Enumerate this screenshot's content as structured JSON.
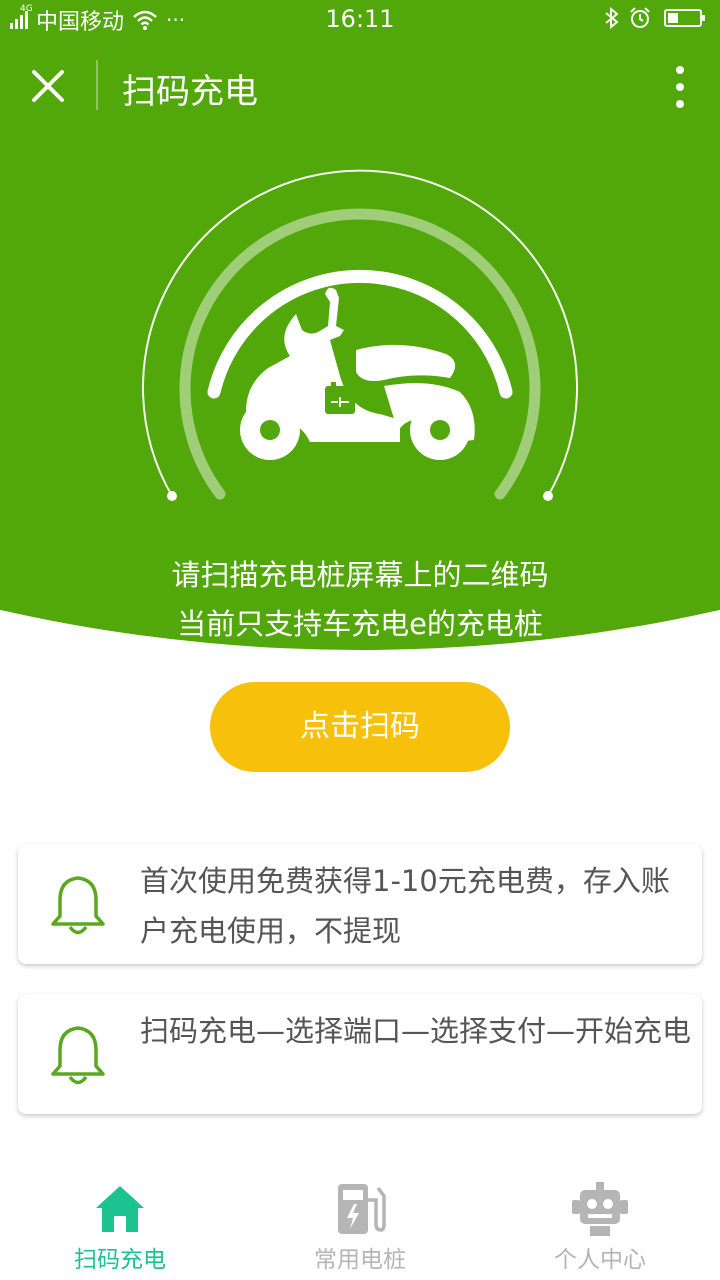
{
  "status": {
    "network": "4G",
    "carrier": "中国移动",
    "dots": "···",
    "time": "16:11"
  },
  "header": {
    "title": "扫码充电"
  },
  "hero": {
    "line1": "请扫描充电桩屏幕上的二维码",
    "line2": "当前只支持车充电e的充电桩"
  },
  "scan_button": "点击扫码",
  "tips": [
    {
      "icon": "bell-icon",
      "text": "首次使用免费获得1-10元充电费，存入账户充电使用，不提现"
    },
    {
      "icon": "bell-icon",
      "text": "扫码充电—选择端口—选择支付—开始充电"
    }
  ],
  "tabs": [
    {
      "label": "扫码充电",
      "icon": "home-icon",
      "active": true
    },
    {
      "label": "常用电桩",
      "icon": "charging-station-icon",
      "active": false
    },
    {
      "label": "个人中心",
      "icon": "robot-icon",
      "active": false
    }
  ],
  "colors": {
    "primary_green": "#52a70a",
    "button_yellow": "#f7c10b",
    "tab_active": "#1cc28f",
    "tab_inactive": "#b5b5b5",
    "bell_green": "#5aa820"
  }
}
